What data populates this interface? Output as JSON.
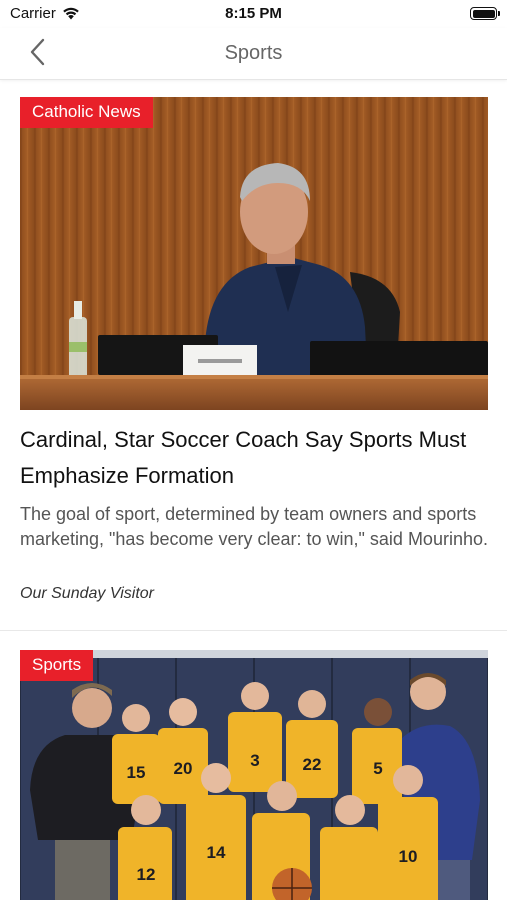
{
  "status_bar": {
    "carrier": "Carrier",
    "time": "8:15 PM",
    "battery_level": 1.0
  },
  "nav": {
    "title": "Sports",
    "back_icon": "chevron-left-icon"
  },
  "articles": [
    {
      "tag": "Catholic News",
      "image": "photo-speaker-at-panel-desk",
      "headline": "Cardinal, Star Soccer Coach Say Sports Must Emphasize Formation",
      "summary": "The goal of sport, determined by team owners and sports marketing, \"has become very clear: to win,\" said Mourinho.",
      "source": "Our Sunday Visitor"
    },
    {
      "tag": "Sports",
      "image": "photo-youth-basketball-team",
      "jersey_numbers": [
        "15",
        "20",
        "3",
        "22",
        "5",
        "12",
        "14",
        "10"
      ]
    }
  ],
  "colors": {
    "tag_red": "#e8202a",
    "jersey_gold": "#f0b429",
    "nav_title": "#666666"
  }
}
